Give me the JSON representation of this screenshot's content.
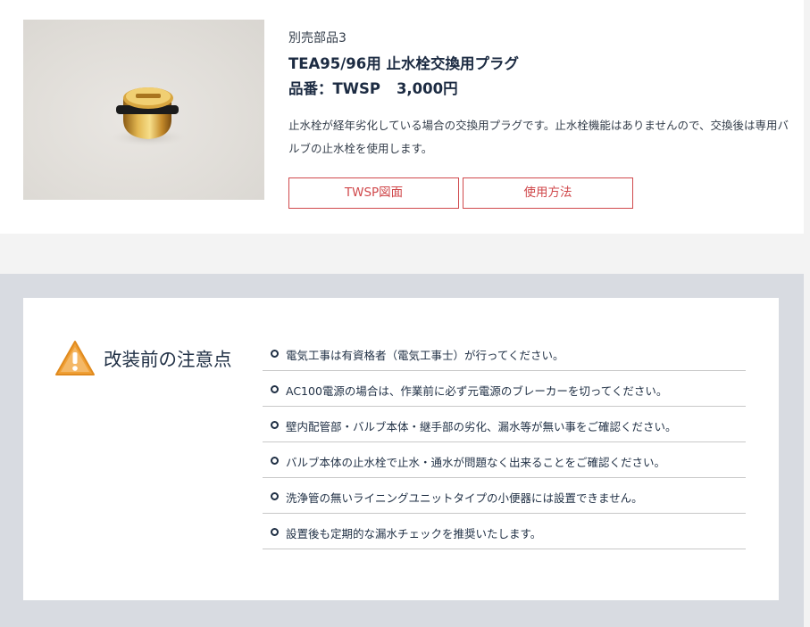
{
  "product": {
    "subtitle": "別売部品3",
    "title": "TEA95/96用 止水栓交換用プラグ",
    "part_label": "品番：TWSP",
    "price": "3,000円",
    "description": "止水栓が経年劣化している場合の交換用プラグです。止水栓機能はありませんので、交換後は専用バルブの止水栓を使用します。",
    "buttons": {
      "drawing": "TWSP図面",
      "usage": "使用方法"
    }
  },
  "notice": {
    "heading": "改装前の注意点",
    "items": [
      "電気工事は有資格者（電気工事士）が行ってください。",
      "AC100電源の場合は、作業前に必ず元電源のブレーカーを切ってください。",
      "壁内配管部・バルブ本体・継手部の劣化、漏水等が無い事をご確認ください。",
      "バルブ本体の止水栓で止水・通水が問題なく出来ることをご確認ください。",
      "洗浄管の無いライニングユニットタイプの小便器には設置できません。",
      "設置後も定期的な漏水チェックを推奨いたします。"
    ]
  },
  "colors": {
    "accent_red": "#d0494c",
    "text_navy": "#1f2f44",
    "warning_orange": "#f0a035",
    "section_gray": "#d8dbe1"
  }
}
